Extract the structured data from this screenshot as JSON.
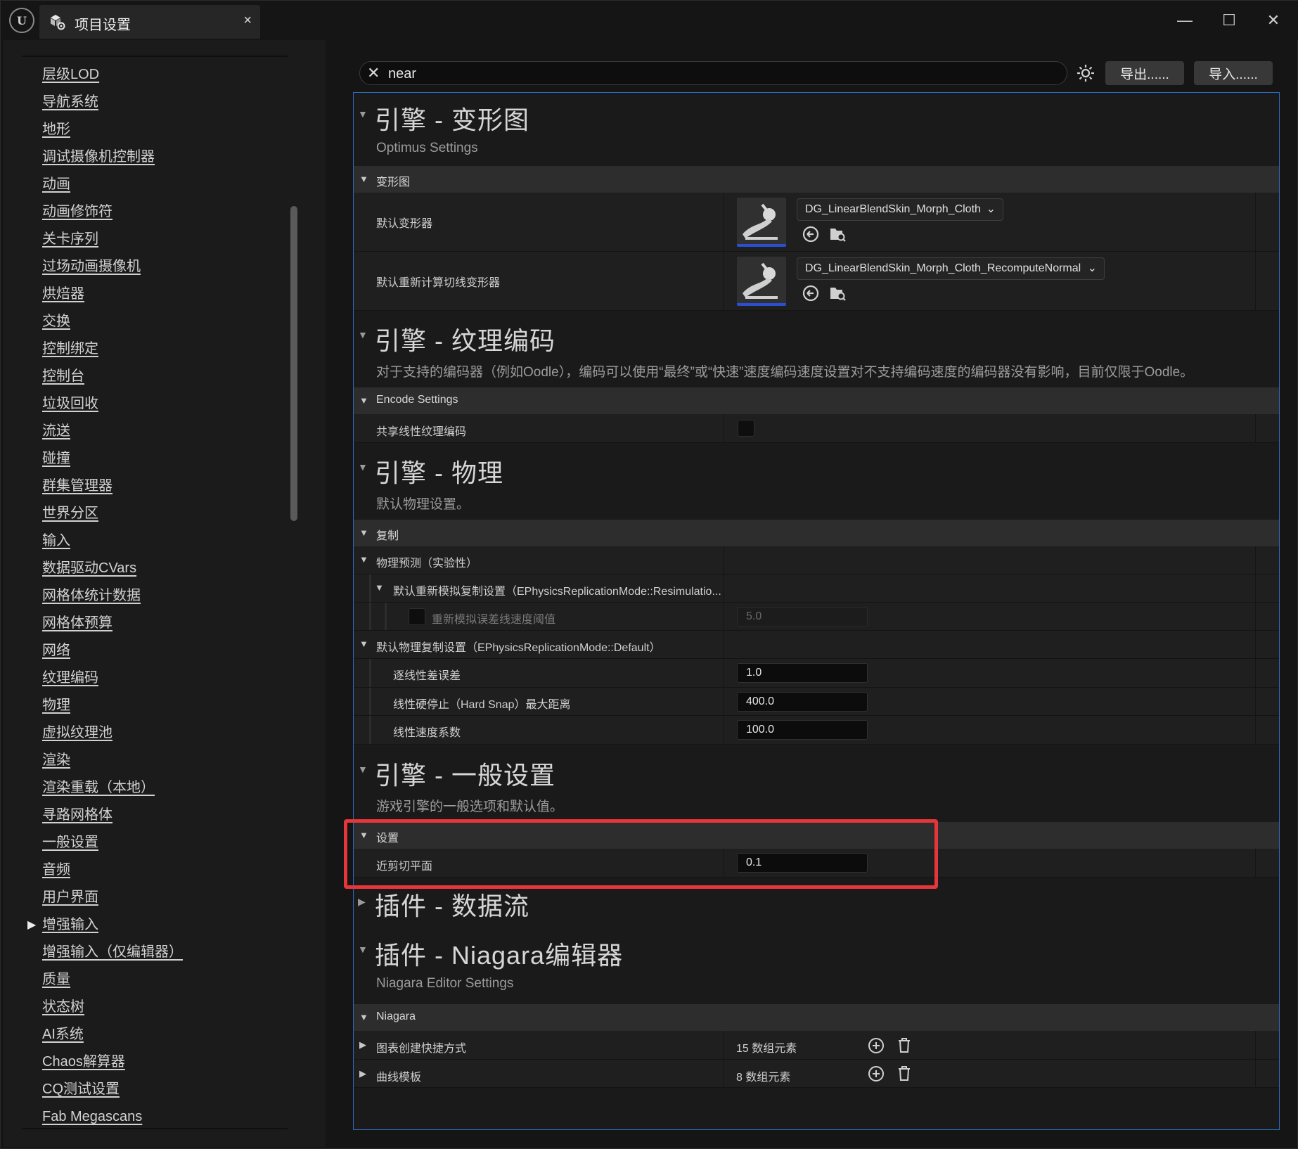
{
  "window": {
    "logo_text": "U",
    "tab_title": "项目设置",
    "tab_close": "×",
    "minimize": "—",
    "maximize": "☐",
    "close": "✕"
  },
  "sidebar": {
    "items": [
      {
        "label": "层级LOD"
      },
      {
        "label": "导航系统"
      },
      {
        "label": "地形"
      },
      {
        "label": "调试摄像机控制器"
      },
      {
        "label": "动画"
      },
      {
        "label": "动画修饰符"
      },
      {
        "label": "关卡序列"
      },
      {
        "label": "过场动画摄像机"
      },
      {
        "label": "烘焙器"
      },
      {
        "label": "交换"
      },
      {
        "label": "控制绑定"
      },
      {
        "label": "控制台"
      },
      {
        "label": "垃圾回收"
      },
      {
        "label": "流送"
      },
      {
        "label": "碰撞"
      },
      {
        "label": "群集管理器"
      },
      {
        "label": "世界分区"
      },
      {
        "label": "输入"
      },
      {
        "label": "数据驱动CVars"
      },
      {
        "label": "网格体统计数据"
      },
      {
        "label": "网格体预算"
      },
      {
        "label": "网络"
      },
      {
        "label": "纹理编码"
      },
      {
        "label": "物理"
      },
      {
        "label": "虚拟纹理池"
      },
      {
        "label": "渲染"
      },
      {
        "label": "渲染重载（本地）"
      },
      {
        "label": "寻路网格体"
      },
      {
        "label": "一般设置"
      },
      {
        "label": "音频"
      },
      {
        "label": "用户界面"
      },
      {
        "label": "增强输入",
        "expandable": true
      },
      {
        "label": "增强输入（仅编辑器）"
      },
      {
        "label": "质量"
      },
      {
        "label": "状态树"
      },
      {
        "label": "AI系统"
      },
      {
        "label": "Chaos解算器"
      },
      {
        "label": "CQ测试设置"
      },
      {
        "label": "Fab Megascans"
      }
    ]
  },
  "search": {
    "value": "near",
    "clear_icon": "✕"
  },
  "toolbar": {
    "export_label": "导出......",
    "import_label": "导入......"
  },
  "sections": {
    "deformer": {
      "title": "引擎 - 变形图",
      "desc": "Optimus Settings",
      "category": "变形图",
      "row1_name": "默认变形器",
      "row1_asset": "DG_LinearBlendSkin_Morph_Cloth",
      "row2_name": "默认重新计算切线变形器",
      "row2_asset": "DG_LinearBlendSkin_Morph_Cloth_RecomputeNormals"
    },
    "texture": {
      "title": "引擎 - 纹理编码",
      "desc": "对于支持的编码器（例如Oodle），编码可以使用“最终”或“快速”速度编码速度设置对不支持编码速度的编码器没有影响，目前仅限于Oodle。",
      "category": "Encode Settings",
      "row1_name": "共享线性纹理编码",
      "row1_checked": false
    },
    "physics": {
      "title": "引擎 - 物理",
      "desc": "默认物理设置。",
      "category": "复制",
      "group1": "物理预测（实验性）",
      "group1_sub": "默认重新模拟复制设置（EPhysicsReplicationMode::Resimulatio...",
      "group1_sub_row": "重新模拟误差线速度阈值",
      "group1_sub_value": "5.0",
      "group2": "默认物理复制设置（EPhysicsReplicationMode::Default）",
      "row_a_name": "逐线性差误差",
      "row_a_value": "1.0",
      "row_b_name": "线性硬停止（Hard Snap）最大距离",
      "row_b_value": "400.0",
      "row_c_name": "线性速度系数",
      "row_c_value": "100.0"
    },
    "general": {
      "title": "引擎 - 一般设置",
      "desc": "游戏引擎的一般选项和默认值。",
      "category": "设置",
      "row1_name": "近剪切平面",
      "row1_value": "0.1"
    },
    "dataflow": {
      "title": "插件 - 数据流"
    },
    "niagara": {
      "title": "插件 - Niagara编辑器",
      "desc": "Niagara Editor Settings",
      "category": "Niagara",
      "row1_name": "图表创建快捷方式",
      "row1_count": "15 数组元素",
      "row2_name": "曲线模板",
      "row2_count": "8 数组元素"
    }
  },
  "colors": {
    "highlight": "#e5363a",
    "panel_border": "#2e6bbf",
    "thumb_accent": "#2a4fd0"
  }
}
